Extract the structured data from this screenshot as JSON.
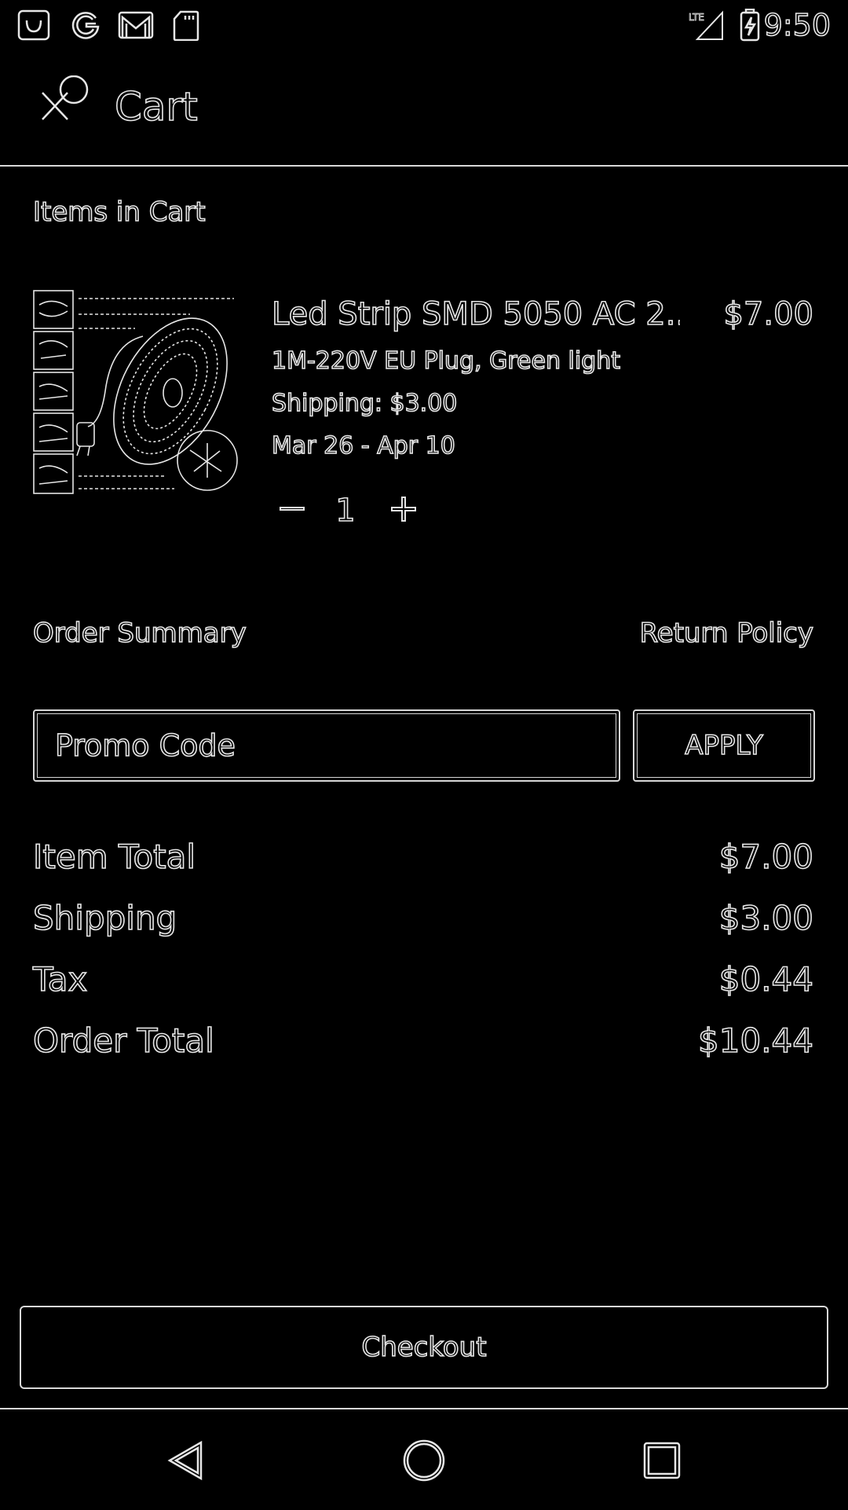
{
  "status_bar": {
    "time": "9:50",
    "left_icons": [
      "shopping-bag-icon",
      "google-icon",
      "gmail-icon",
      "sd-card-icon"
    ],
    "right_icons": [
      "lte-signal-icon",
      "battery-charging-icon"
    ],
    "network_label": "LTE"
  },
  "app_bar": {
    "title": "Cart",
    "close_icon": "close-icon"
  },
  "cart": {
    "section_title": "Items in Cart",
    "items": [
      {
        "name": "Led Strip SMD 5050 AC 2...",
        "price": "$7.00",
        "variant": "1M-220V EU Plug, Green light",
        "shipping": "Shipping: $3.00",
        "delivery": "Mar 26 - Apr 10",
        "quantity": "1",
        "thumbnail": "led-strip-product-image"
      }
    ]
  },
  "summary": {
    "title": "Order Summary",
    "return_policy": "Return Policy",
    "promo_placeholder": "Promo Code",
    "apply_label": "APPLY",
    "rows": [
      {
        "label": "Item Total",
        "value": "$7.00"
      },
      {
        "label": "Shipping",
        "value": "$3.00"
      },
      {
        "label": "Tax",
        "value": "$0.44"
      },
      {
        "label": "Order Total",
        "value": "$10.44"
      }
    ]
  },
  "checkout_label": "Checkout",
  "nav": {
    "back_icon": "back-triangle-icon",
    "home_icon": "home-circle-icon",
    "recents_icon": "recents-square-icon"
  },
  "colors": {
    "background": "#000000",
    "line": "#e6e6e6"
  }
}
